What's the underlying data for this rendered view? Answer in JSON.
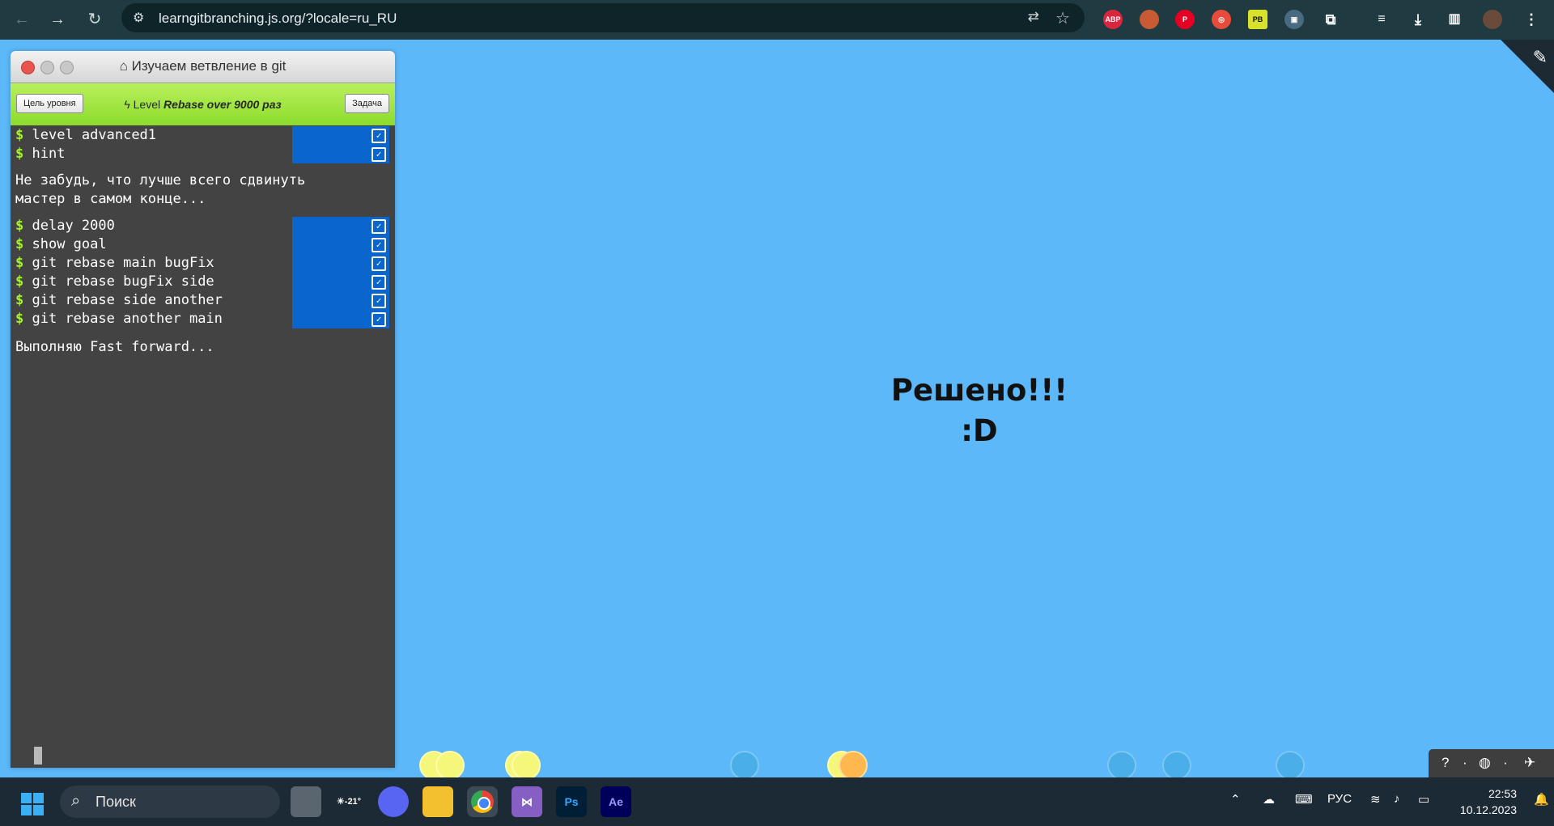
{
  "browser": {
    "url": "learngitbranching.js.org/?locale=ru_RU",
    "extensions": [
      "ABP",
      "PB"
    ]
  },
  "window": {
    "title": "Изучаем ветвление в git",
    "goal_button": "Цель уровня",
    "task_button": "Задача",
    "level_prefix": "Level",
    "level_name": "Rebase over 9000 раз"
  },
  "terminal": {
    "prompt": "$",
    "commands_top": [
      "level advanced1",
      "hint"
    ],
    "hint_message": "Не забудь, что лучше всего сдвинуть\nмастер в самом конце...",
    "commands_main": [
      "delay 2000",
      "show goal",
      "git rebase main bugFix",
      "git rebase bugFix side",
      "git rebase side another",
      "git rebase another main"
    ],
    "status_message": "Выполняю Fast forward..."
  },
  "main": {
    "solved_line1": "Решено!!!",
    "solved_line2": ":D"
  },
  "taskbar": {
    "search_label": "Поиск",
    "weather": "-21°",
    "app_ps": "Ps",
    "app_ae": "Ae",
    "language": "РУС",
    "time": "22:53",
    "date": "10.12.2023"
  }
}
